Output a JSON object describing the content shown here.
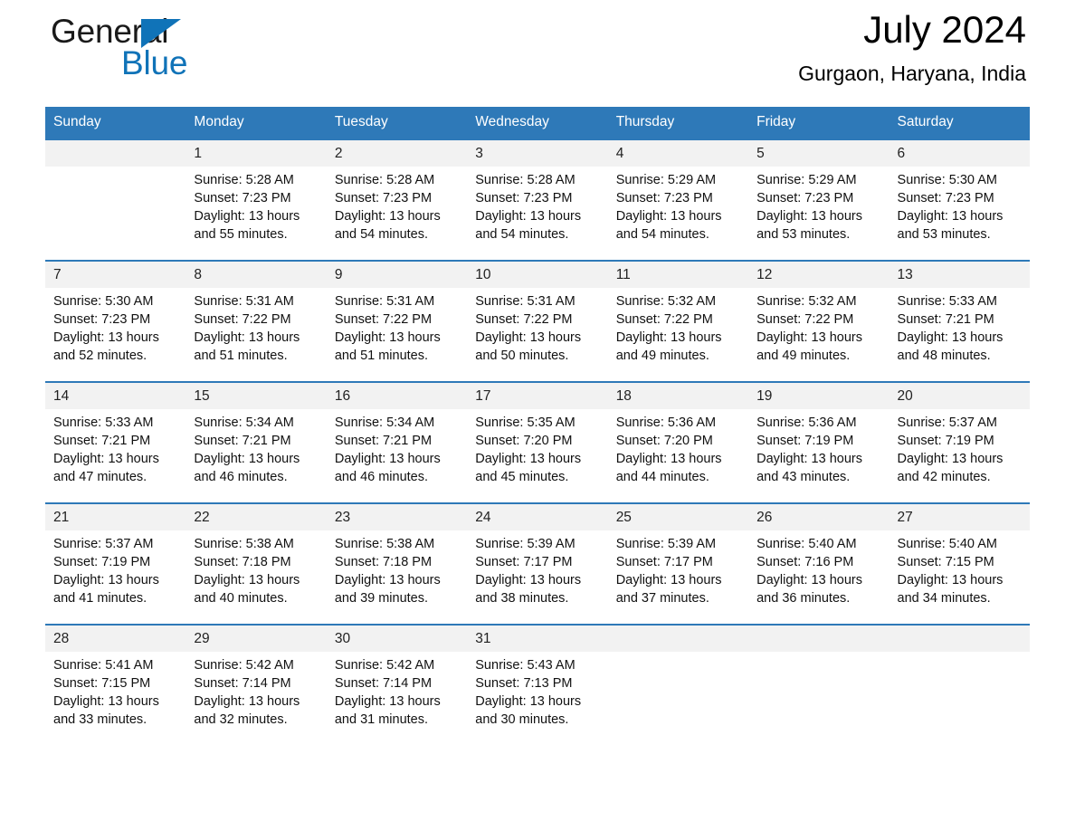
{
  "brand": {
    "name_part1": "General",
    "name_part2": "Blue",
    "triangle_color": "#1073b8"
  },
  "header": {
    "title": "July 2024",
    "location": "Gurgaon, Haryana, India"
  },
  "theme": {
    "header_blue": "#2e79b8",
    "daynum_band": "#f2f2f2",
    "accent_rule": "#2e79b8"
  },
  "weekdays": [
    "Sunday",
    "Monday",
    "Tuesday",
    "Wednesday",
    "Thursday",
    "Friday",
    "Saturday"
  ],
  "weeks": [
    [
      {
        "day": "",
        "lines": []
      },
      {
        "day": "1",
        "lines": [
          "Sunrise: 5:28 AM",
          "Sunset: 7:23 PM",
          "Daylight: 13 hours",
          "and 55 minutes."
        ]
      },
      {
        "day": "2",
        "lines": [
          "Sunrise: 5:28 AM",
          "Sunset: 7:23 PM",
          "Daylight: 13 hours",
          "and 54 minutes."
        ]
      },
      {
        "day": "3",
        "lines": [
          "Sunrise: 5:28 AM",
          "Sunset: 7:23 PM",
          "Daylight: 13 hours",
          "and 54 minutes."
        ]
      },
      {
        "day": "4",
        "lines": [
          "Sunrise: 5:29 AM",
          "Sunset: 7:23 PM",
          "Daylight: 13 hours",
          "and 54 minutes."
        ]
      },
      {
        "day": "5",
        "lines": [
          "Sunrise: 5:29 AM",
          "Sunset: 7:23 PM",
          "Daylight: 13 hours",
          "and 53 minutes."
        ]
      },
      {
        "day": "6",
        "lines": [
          "Sunrise: 5:30 AM",
          "Sunset: 7:23 PM",
          "Daylight: 13 hours",
          "and 53 minutes."
        ]
      }
    ],
    [
      {
        "day": "7",
        "lines": [
          "Sunrise: 5:30 AM",
          "Sunset: 7:23 PM",
          "Daylight: 13 hours",
          "and 52 minutes."
        ]
      },
      {
        "day": "8",
        "lines": [
          "Sunrise: 5:31 AM",
          "Sunset: 7:22 PM",
          "Daylight: 13 hours",
          "and 51 minutes."
        ]
      },
      {
        "day": "9",
        "lines": [
          "Sunrise: 5:31 AM",
          "Sunset: 7:22 PM",
          "Daylight: 13 hours",
          "and 51 minutes."
        ]
      },
      {
        "day": "10",
        "lines": [
          "Sunrise: 5:31 AM",
          "Sunset: 7:22 PM",
          "Daylight: 13 hours",
          "and 50 minutes."
        ]
      },
      {
        "day": "11",
        "lines": [
          "Sunrise: 5:32 AM",
          "Sunset: 7:22 PM",
          "Daylight: 13 hours",
          "and 49 minutes."
        ]
      },
      {
        "day": "12",
        "lines": [
          "Sunrise: 5:32 AM",
          "Sunset: 7:22 PM",
          "Daylight: 13 hours",
          "and 49 minutes."
        ]
      },
      {
        "day": "13",
        "lines": [
          "Sunrise: 5:33 AM",
          "Sunset: 7:21 PM",
          "Daylight: 13 hours",
          "and 48 minutes."
        ]
      }
    ],
    [
      {
        "day": "14",
        "lines": [
          "Sunrise: 5:33 AM",
          "Sunset: 7:21 PM",
          "Daylight: 13 hours",
          "and 47 minutes."
        ]
      },
      {
        "day": "15",
        "lines": [
          "Sunrise: 5:34 AM",
          "Sunset: 7:21 PM",
          "Daylight: 13 hours",
          "and 46 minutes."
        ]
      },
      {
        "day": "16",
        "lines": [
          "Sunrise: 5:34 AM",
          "Sunset: 7:21 PM",
          "Daylight: 13 hours",
          "and 46 minutes."
        ]
      },
      {
        "day": "17",
        "lines": [
          "Sunrise: 5:35 AM",
          "Sunset: 7:20 PM",
          "Daylight: 13 hours",
          "and 45 minutes."
        ]
      },
      {
        "day": "18",
        "lines": [
          "Sunrise: 5:36 AM",
          "Sunset: 7:20 PM",
          "Daylight: 13 hours",
          "and 44 minutes."
        ]
      },
      {
        "day": "19",
        "lines": [
          "Sunrise: 5:36 AM",
          "Sunset: 7:19 PM",
          "Daylight: 13 hours",
          "and 43 minutes."
        ]
      },
      {
        "day": "20",
        "lines": [
          "Sunrise: 5:37 AM",
          "Sunset: 7:19 PM",
          "Daylight: 13 hours",
          "and 42 minutes."
        ]
      }
    ],
    [
      {
        "day": "21",
        "lines": [
          "Sunrise: 5:37 AM",
          "Sunset: 7:19 PM",
          "Daylight: 13 hours",
          "and 41 minutes."
        ]
      },
      {
        "day": "22",
        "lines": [
          "Sunrise: 5:38 AM",
          "Sunset: 7:18 PM",
          "Daylight: 13 hours",
          "and 40 minutes."
        ]
      },
      {
        "day": "23",
        "lines": [
          "Sunrise: 5:38 AM",
          "Sunset: 7:18 PM",
          "Daylight: 13 hours",
          "and 39 minutes."
        ]
      },
      {
        "day": "24",
        "lines": [
          "Sunrise: 5:39 AM",
          "Sunset: 7:17 PM",
          "Daylight: 13 hours",
          "and 38 minutes."
        ]
      },
      {
        "day": "25",
        "lines": [
          "Sunrise: 5:39 AM",
          "Sunset: 7:17 PM",
          "Daylight: 13 hours",
          "and 37 minutes."
        ]
      },
      {
        "day": "26",
        "lines": [
          "Sunrise: 5:40 AM",
          "Sunset: 7:16 PM",
          "Daylight: 13 hours",
          "and 36 minutes."
        ]
      },
      {
        "day": "27",
        "lines": [
          "Sunrise: 5:40 AM",
          "Sunset: 7:15 PM",
          "Daylight: 13 hours",
          "and 34 minutes."
        ]
      }
    ],
    [
      {
        "day": "28",
        "lines": [
          "Sunrise: 5:41 AM",
          "Sunset: 7:15 PM",
          "Daylight: 13 hours",
          "and 33 minutes."
        ]
      },
      {
        "day": "29",
        "lines": [
          "Sunrise: 5:42 AM",
          "Sunset: 7:14 PM",
          "Daylight: 13 hours",
          "and 32 minutes."
        ]
      },
      {
        "day": "30",
        "lines": [
          "Sunrise: 5:42 AM",
          "Sunset: 7:14 PM",
          "Daylight: 13 hours",
          "and 31 minutes."
        ]
      },
      {
        "day": "31",
        "lines": [
          "Sunrise: 5:43 AM",
          "Sunset: 7:13 PM",
          "Daylight: 13 hours",
          "and 30 minutes."
        ]
      },
      {
        "day": "",
        "lines": []
      },
      {
        "day": "",
        "lines": []
      },
      {
        "day": "",
        "lines": []
      }
    ]
  ]
}
